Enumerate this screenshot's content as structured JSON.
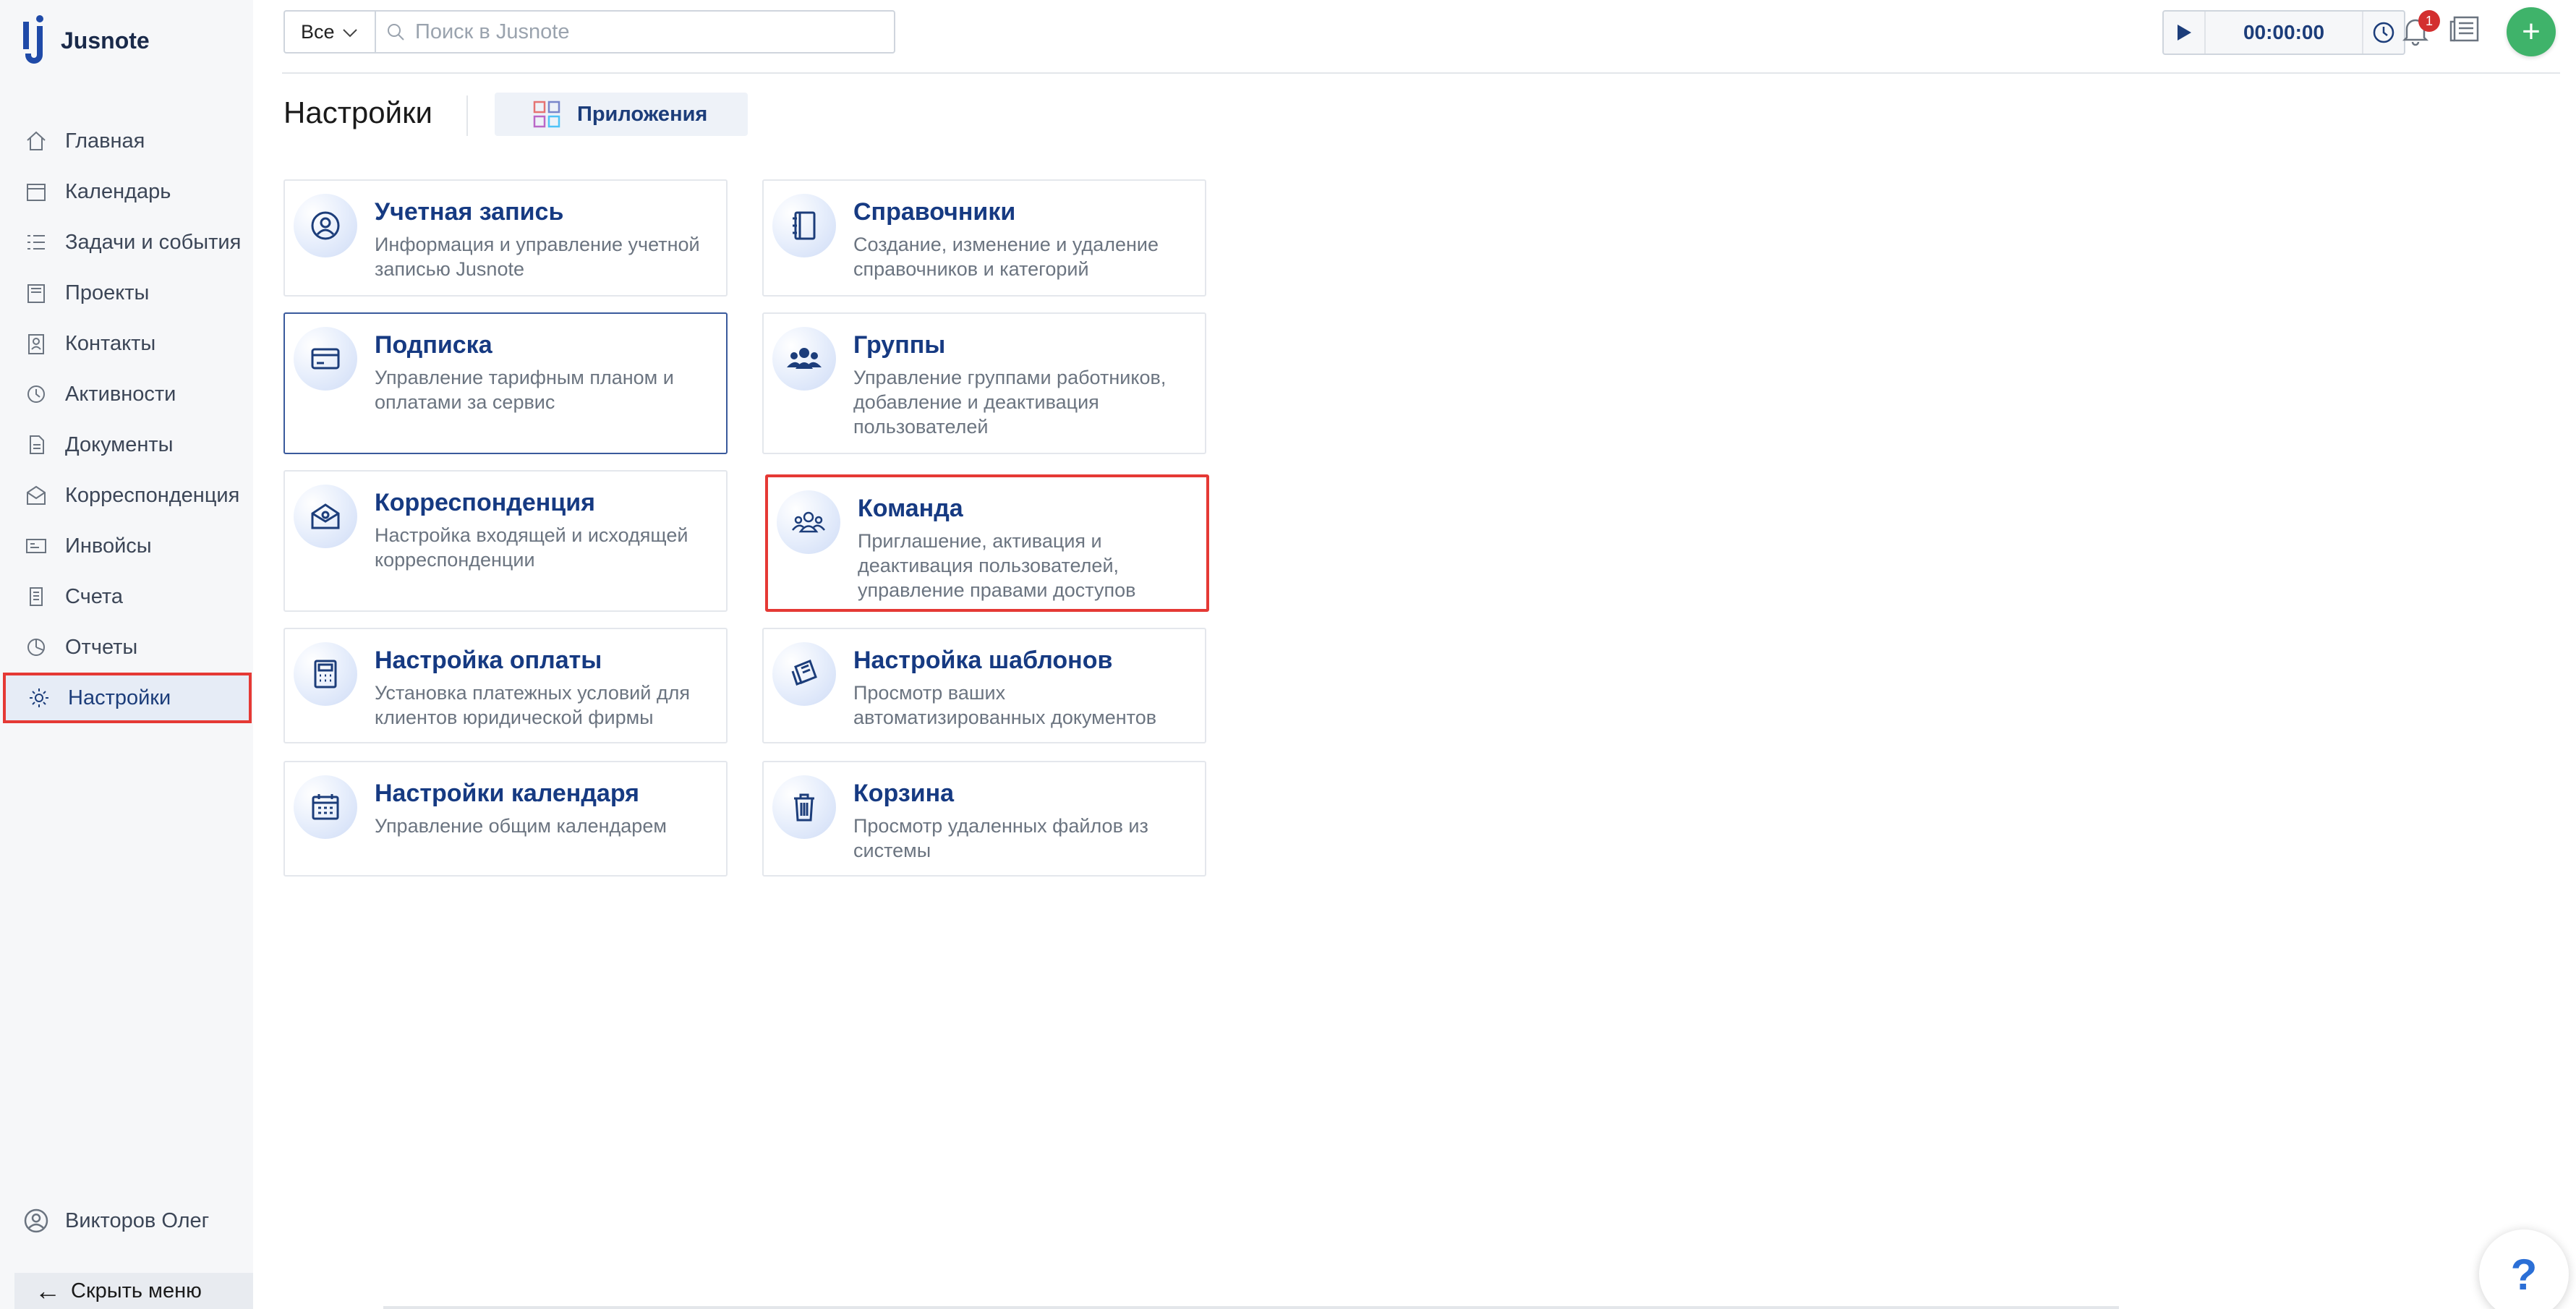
{
  "app": {
    "name": "Jusnote"
  },
  "sidebar": {
    "items": [
      {
        "label": "Главная",
        "icon": "home-icon"
      },
      {
        "label": "Календарь",
        "icon": "calendar-icon"
      },
      {
        "label": "Задачи и события",
        "icon": "tasks-icon"
      },
      {
        "label": "Проекты",
        "icon": "projects-icon"
      },
      {
        "label": "Контакты",
        "icon": "contacts-icon"
      },
      {
        "label": "Активности",
        "icon": "activity-icon"
      },
      {
        "label": "Документы",
        "icon": "documents-icon"
      },
      {
        "label": "Корреспонденция",
        "icon": "correspondence-icon"
      },
      {
        "label": "Инвойсы",
        "icon": "invoices-icon"
      },
      {
        "label": "Счета",
        "icon": "accounts-icon"
      },
      {
        "label": "Отчеты",
        "icon": "reports-icon"
      },
      {
        "label": "Настройки",
        "icon": "gear-icon",
        "active": true
      }
    ],
    "user": "Викторов Олег",
    "hide_menu": "Скрыть меню"
  },
  "topbar": {
    "filter": "Все",
    "search_placeholder": "Поиск в Jusnote",
    "timer": "00:00:00",
    "notifications": "1"
  },
  "page": {
    "title": "Настройки",
    "apps_tab": "Приложения"
  },
  "cards": [
    {
      "title": "Учетная запись",
      "desc": "Информация и управление учетной записью Jusnote",
      "icon": "user-circle-icon"
    },
    {
      "title": "Справочники",
      "desc": "Создание, изменение и удаление справочников и категорий",
      "icon": "book-icon"
    },
    {
      "title": "Подписка",
      "desc": "Управление тарифным планом и оплатами за сервис",
      "icon": "credit-card-icon"
    },
    {
      "title": "Группы",
      "desc": "Управление группами работников, добавление и деактивация пользователей",
      "icon": "group-icon"
    },
    {
      "title": "Корреспонденция",
      "desc": "Настройка входящей и исходящей корреспонденции",
      "icon": "envelope-icon"
    },
    {
      "title": "Команда",
      "desc": "Приглашение, активация и деактивация пользователей, управление правами доступов",
      "icon": "team-icon"
    },
    {
      "title": "Настройка оплаты",
      "desc": "Установка платежных условий для клиентов юридической фирмы",
      "icon": "calculator-icon"
    },
    {
      "title": "Настройка шаблонов",
      "desc": "Просмотр ваших автоматизированных документов",
      "icon": "templates-icon"
    },
    {
      "title": "Настройки календаря",
      "desc": "Управление общим календарем",
      "icon": "calendar-icon"
    },
    {
      "title": "Корзина",
      "desc": "Просмотр удаленных файлов из системы",
      "icon": "trash-icon"
    }
  ],
  "help": "?",
  "colors": {
    "accent": "#163a82",
    "highlight": "#e53935",
    "add": "#3fb36a"
  }
}
